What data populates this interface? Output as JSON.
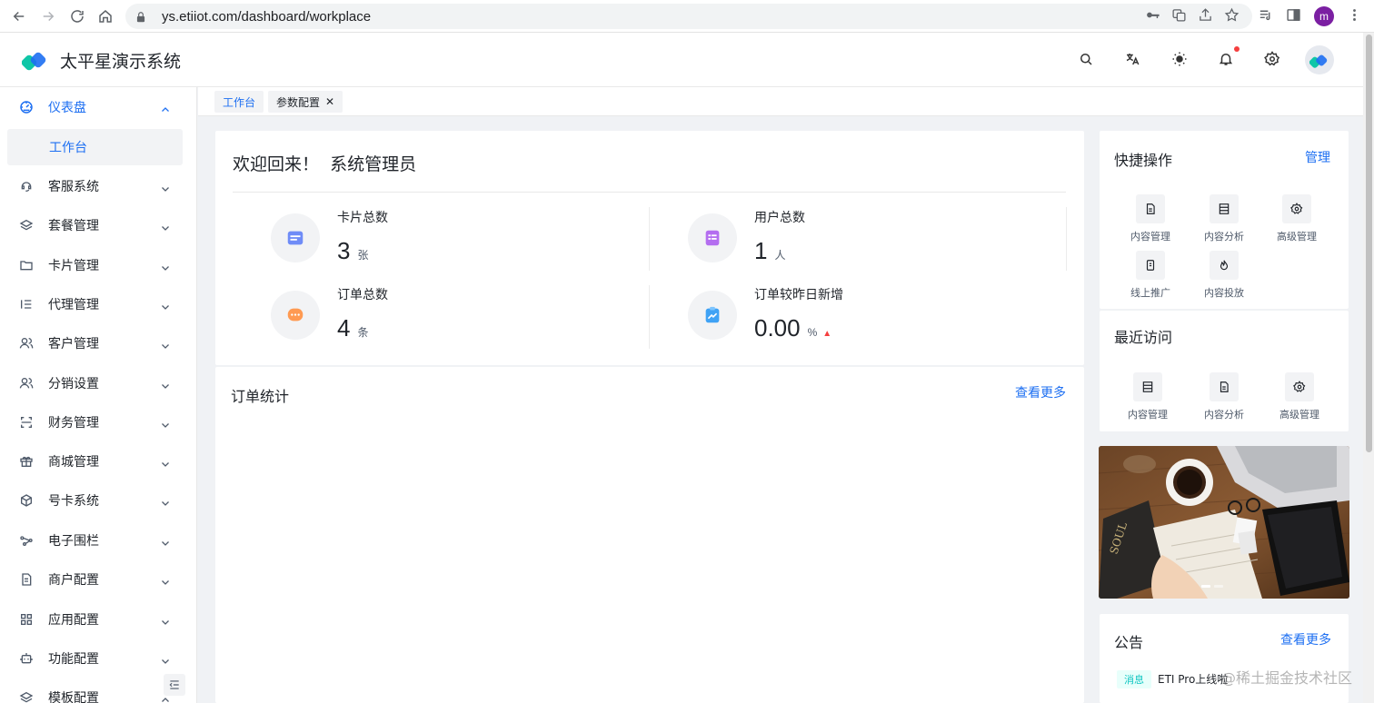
{
  "browser": {
    "url": "ys.etiiot.com/dashboard/workplace",
    "profile_initial": "m"
  },
  "app": {
    "title": "太平星演示系统"
  },
  "sidebar": {
    "items": [
      {
        "label": "仪表盘",
        "icon": "dashboard-icon"
      },
      {
        "label": "客服系统",
        "icon": "headset-icon"
      },
      {
        "label": "套餐管理",
        "icon": "layers-icon"
      },
      {
        "label": "卡片管理",
        "icon": "folder-icon"
      },
      {
        "label": "代理管理",
        "icon": "list-icon"
      },
      {
        "label": "客户管理",
        "icon": "users-icon"
      },
      {
        "label": "分销设置",
        "icon": "user-group-icon"
      },
      {
        "label": "财务管理",
        "icon": "scan-icon"
      },
      {
        "label": "商城管理",
        "icon": "gift-icon"
      },
      {
        "label": "号卡系统",
        "icon": "box-icon"
      },
      {
        "label": "电子围栏",
        "icon": "share-icon"
      },
      {
        "label": "商户配置",
        "icon": "file-icon"
      },
      {
        "label": "应用配置",
        "icon": "apps-icon"
      },
      {
        "label": "功能配置",
        "icon": "robot-icon"
      },
      {
        "label": "模板配置",
        "icon": "layers-icon"
      }
    ],
    "submenu_active": "工作台"
  },
  "tabs": [
    {
      "label": "工作台",
      "active": true
    },
    {
      "label": "参数配置",
      "active": false,
      "close": "✕"
    }
  ],
  "welcome": {
    "greeting": "欢迎回来！",
    "user": "系统管理员",
    "stats": [
      {
        "label": "卡片总数",
        "value": "3",
        "unit": "张",
        "color": "#6f8cf7"
      },
      {
        "label": "用户总数",
        "value": "1",
        "unit": "人",
        "color": "#b46ef0"
      },
      {
        "label": "订单总数",
        "value": "4",
        "unit": "条",
        "color": "#ff9a52"
      },
      {
        "label": "订单较昨日新增",
        "value": "0.00",
        "unit": "%",
        "trend": "▲",
        "color": "#3fa2f5"
      }
    ]
  },
  "orders": {
    "title": "订单统计",
    "more": "查看更多"
  },
  "quick_actions": {
    "title": "快捷操作",
    "manage": "管理",
    "items": [
      {
        "label": "内容管理",
        "icon": "document-icon"
      },
      {
        "label": "内容分析",
        "icon": "table-icon"
      },
      {
        "label": "高级管理",
        "icon": "gear-icon"
      },
      {
        "label": "线上推广",
        "icon": "mobile-icon"
      },
      {
        "label": "内容投放",
        "icon": "fire-icon"
      }
    ]
  },
  "recent": {
    "title": "最近访问",
    "items": [
      {
        "label": "内容管理",
        "icon": "table-icon"
      },
      {
        "label": "内容分析",
        "icon": "document-icon"
      },
      {
        "label": "高级管理",
        "icon": "gear-icon"
      }
    ]
  },
  "notice": {
    "title": "公告",
    "more": "查看更多",
    "items": [
      {
        "tag": "消息",
        "text": "ETI Pro上线啦"
      }
    ]
  },
  "watermark": "@稀土掘金技术社区",
  "colors": {
    "primary": "#1d6ff2",
    "danger": "#f53f3f",
    "tag_teal": "#0fc6c2"
  }
}
